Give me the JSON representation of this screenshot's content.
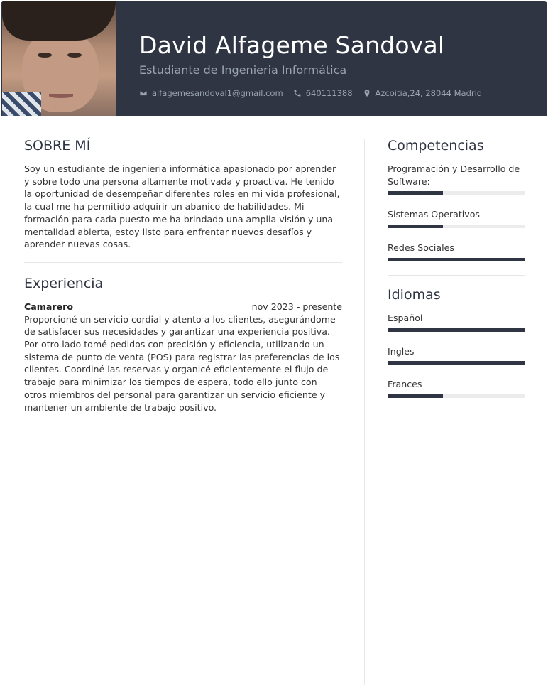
{
  "header": {
    "name": "David Alfageme Sandoval",
    "subtitle": "Estudiante de Ingenieria Informática",
    "email": "alfagemesandoval1@gmail.com",
    "phone": "640111388",
    "address": "Azcoitia,24, 28044 Madrid"
  },
  "about": {
    "title": "SOBRE MÍ",
    "text": "Soy un estudiante de ingenieria informática apasionado por aprender y sobre todo una persona altamente motivada y proactiva. He tenido la oportunidad de desempeñar diferentes roles en mi vida profesional, la cual me ha permitido adquirir un abanico de habilidades. Mi formación para cada puesto me ha brindado una amplia visión y una mentalidad abierta, estoy listo para enfrentar nuevos desafíos y aprender nuevas cosas."
  },
  "experience": {
    "title": "Experiencia",
    "jobs": [
      {
        "title": "Camarero",
        "date": "nov 2023 - presente",
        "description": "Proporcioné un servicio cordial y atento a los clientes, asegurándome de satisfacer sus necesidades y garantizar una experiencia positiva. Por otro lado tomé pedidos con precisión y eficiencia, utilizando un sistema de punto de venta (POS) para registrar las preferencias de los clientes. Coordiné las reservas y organicé eficientemente el flujo de trabajo para minimizar los tiempos de espera, todo ello junto con otros miembros del personal para garantizar un servicio eficiente y mantener un ambiente de trabajo positivo."
      }
    ]
  },
  "skills": {
    "title": "Competencias",
    "items": [
      {
        "name": "Programación y Desarrollo de Software:",
        "level": 0.4
      },
      {
        "name": "Sistemas Operativos",
        "level": 0.4
      },
      {
        "name": "Redes Sociales",
        "level": 1.0
      }
    ]
  },
  "languages": {
    "title": "Idiomas",
    "items": [
      {
        "name": "Español",
        "level": 1.0
      },
      {
        "name": "Ingles",
        "level": 1.0
      },
      {
        "name": "Frances",
        "level": 0.4
      }
    ]
  },
  "colors": {
    "header_bg": "#2f3542",
    "accent": "#2f3542",
    "bar_track": "#ececec"
  },
  "icons": [
    "envelope-icon",
    "phone-icon",
    "map-pin-icon"
  ]
}
